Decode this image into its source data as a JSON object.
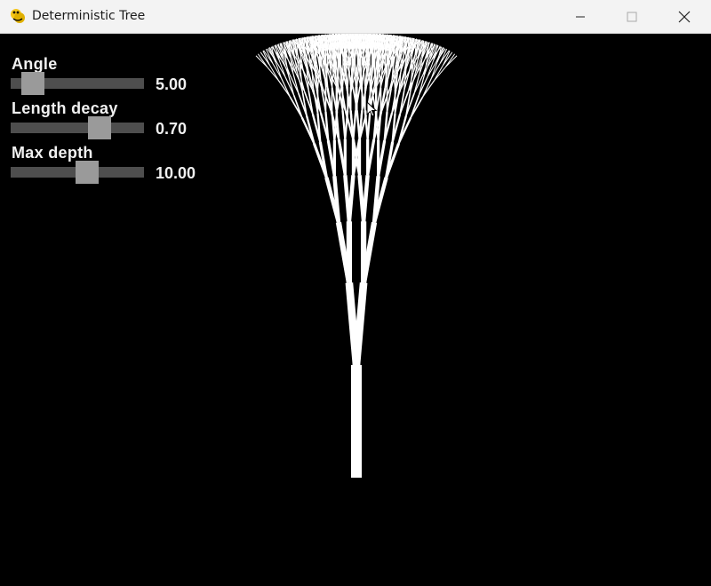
{
  "window": {
    "title": "Deterministic Tree",
    "icon": "python-snake-icon",
    "controls": [
      "minimize",
      "maximize",
      "close"
    ]
  },
  "sliders": [
    {
      "label": "Angle",
      "value": "5.00",
      "level": 0.1
    },
    {
      "label": "Length decay",
      "value": "0.70",
      "level": 0.7
    },
    {
      "label": "Max depth",
      "value": "10.00",
      "level": 0.59
    }
  ],
  "colors": {
    "background": "#000000",
    "tree": "#ffffff",
    "track": "#4e4e4e",
    "knob": "#9a9a9a",
    "text": "#f0f0f0"
  }
}
